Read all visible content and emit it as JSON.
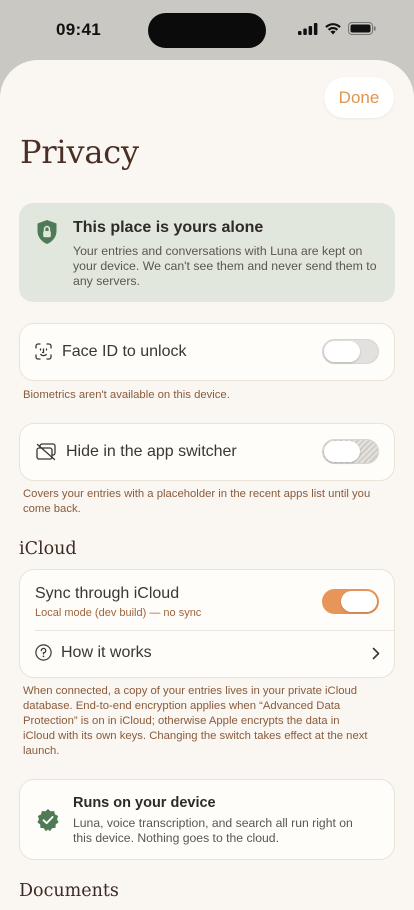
{
  "status_bar": {
    "time": "09:41"
  },
  "header": {
    "done_label": "Done",
    "title": "Privacy"
  },
  "banner": {
    "title": "This place is yours alone",
    "body": "Your entries and conversations with Luna are kept on your device. We can't see them and never send them to any servers."
  },
  "face_id": {
    "label": "Face ID to unlock",
    "enabled": false,
    "note": "Biometrics aren't available on this device."
  },
  "app_switcher": {
    "label": "Hide in the app switcher",
    "enabled": false,
    "note": "Covers your entries with a placeholder in the recent apps list until you come back."
  },
  "icloud": {
    "section_title": "iCloud",
    "sync_label": "Sync through iCloud",
    "sync_status": "Local mode (dev build) — no sync",
    "sync_enabled": true,
    "how_it_works_label": "How it works",
    "note": "When connected, a copy of your entries lives in your private iCloud database. End-to-end encryption applies when “Advanced Data Protection” is on in iCloud; otherwise Apple encrypts the data in iCloud with its own keys. Changing the switch takes effect at the next launch."
  },
  "on_device": {
    "title": "Runs on your device",
    "body": "Luna, voice transcription, and search all run right on this device. Nothing goes to the cloud."
  },
  "documents": {
    "section_title": "Documents"
  },
  "colors": {
    "accent": "#e8955a",
    "banner_bg": "#e2e7dd",
    "success": "#4e7a55"
  }
}
